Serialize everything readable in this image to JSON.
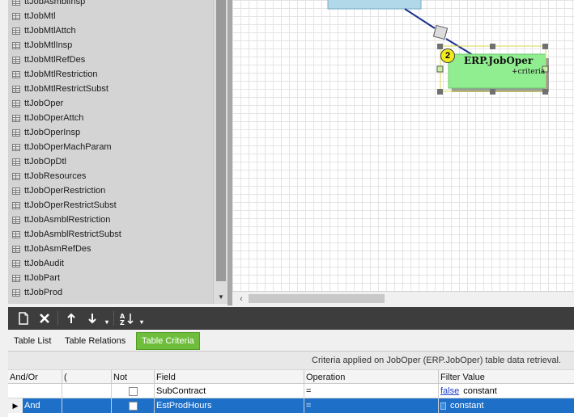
{
  "table_list": {
    "partial_top_item": "ttJobAsmblInsp",
    "items": [
      "ttJobMtl",
      "ttJobMtlAttch",
      "ttJobMtlInsp",
      "ttJobMtlRefDes",
      "ttJobMtlRestriction",
      "ttJobMtlRestrictSubst",
      "ttJobOper",
      "ttJobOperAttch",
      "ttJobOperInsp",
      "ttJobOperMachParam",
      "ttJobOpDtl",
      "ttJobResources",
      "ttJobOperRestriction",
      "ttJobOperRestrictSubst",
      "ttJobAsmblRestriction",
      "ttJobAsmblRestrictSubst",
      "ttJobAsmRefDes",
      "ttJobAudit",
      "ttJobPart",
      "ttJobProd"
    ]
  },
  "diagram": {
    "node_title": "ERP.JobOper",
    "node_subtitle": "+criteria",
    "node_badge": "2",
    "node_color": "#90ee90",
    "parent_node_color": "#b0d8e8"
  },
  "toolbar": {
    "buttons": [
      "new-icon",
      "delete-icon",
      "move-up-icon",
      "move-down-icon",
      "sort-icon"
    ]
  },
  "tabs": {
    "table_list": "Table List",
    "table_relations": "Table Relations",
    "table_criteria": "Table Criteria",
    "active_color": "#6ebe3c"
  },
  "grid": {
    "caption": "Criteria applied on JobOper (ERP.JobOper)  table data retrieval.",
    "columns": [
      "And/Or",
      "(",
      "Not",
      "Field",
      "Operation",
      "Filter Value"
    ],
    "rows": [
      {
        "andor": "",
        "paren": "",
        "not": false,
        "field": "SubContract",
        "operation": "=",
        "filter_value": "false",
        "filter_type": "constant",
        "selected": false
      },
      {
        "andor": "And",
        "paren": "",
        "not": false,
        "field": "EstProdHours",
        "operation": "=",
        "filter_value": "",
        "filter_type": "constant",
        "selected": true
      }
    ],
    "selected_color": "#1e6fc8"
  }
}
